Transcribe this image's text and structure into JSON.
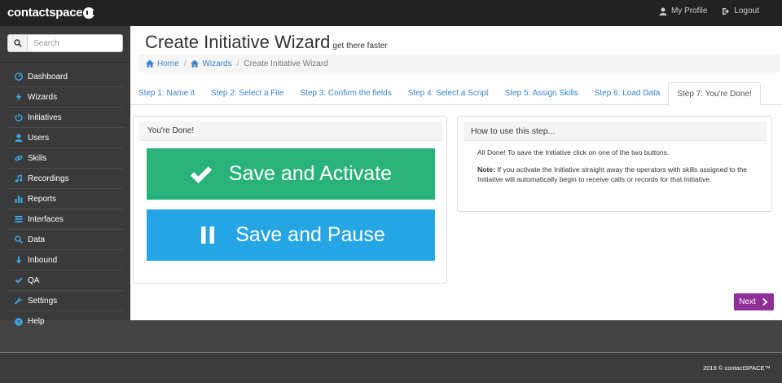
{
  "topbar": {
    "logo_text": "contactspace",
    "my_profile": "My Profile",
    "logout": "Logout"
  },
  "sidebar": {
    "search_placeholder": "Search",
    "items": [
      {
        "label": "Dashboard",
        "icon": "dashboard-icon"
      },
      {
        "label": "Wizards",
        "icon": "bolt-icon"
      },
      {
        "label": "Initiatives",
        "icon": "power-icon"
      },
      {
        "label": "Users",
        "icon": "user-icon"
      },
      {
        "label": "Skills",
        "icon": "link-icon"
      },
      {
        "label": "Recordings",
        "icon": "music-icon"
      },
      {
        "label": "Reports",
        "icon": "bar-chart-icon"
      },
      {
        "label": "Interfaces",
        "icon": "list-icon"
      },
      {
        "label": "Data",
        "icon": "search-icon"
      },
      {
        "label": "Inbound",
        "icon": "arrow-down-icon"
      },
      {
        "label": "QA",
        "icon": "check-icon"
      },
      {
        "label": "Settings",
        "icon": "wrench-icon"
      },
      {
        "label": "Help",
        "icon": "question-icon"
      }
    ]
  },
  "page": {
    "title": "Create Initiative Wizard",
    "subtitle": "get there faster"
  },
  "breadcrumb": {
    "home": "Home",
    "wizards": "Wizards",
    "current": "Create Initiative Wizard"
  },
  "tabs": [
    {
      "label": "Step 1: Name it"
    },
    {
      "label": "Step 2: Select a File"
    },
    {
      "label": "Step 3: Confirm the fields"
    },
    {
      "label": "Step 4: Select a Script"
    },
    {
      "label": "Step 5: Assign Skills"
    },
    {
      "label": "Step 6: Load Data"
    },
    {
      "label": "Step 7: You're Done!"
    }
  ],
  "left_panel": {
    "heading": "You're Done!",
    "activate_label": "Save and Activate",
    "pause_label": "Save and Pause"
  },
  "right_panel": {
    "heading": "How to use this step...",
    "para1": "All Done! To save the Initiative click on one of the two buttons.",
    "note_label": "Note:",
    "note_text": " If you activate the Initiative straight away the operators with skills assigned to the Initiative will automatically begin to receive calls or records for that Initiative."
  },
  "next_label": "Next",
  "footer": {
    "copyright": "2019 © contactSPACE™"
  },
  "colors": {
    "activate": "#2ab27b",
    "pause": "#26a5e4",
    "next": "#8e2f9a",
    "link": "#3a84c7",
    "sidebar_icon": "#3fa7e6"
  }
}
